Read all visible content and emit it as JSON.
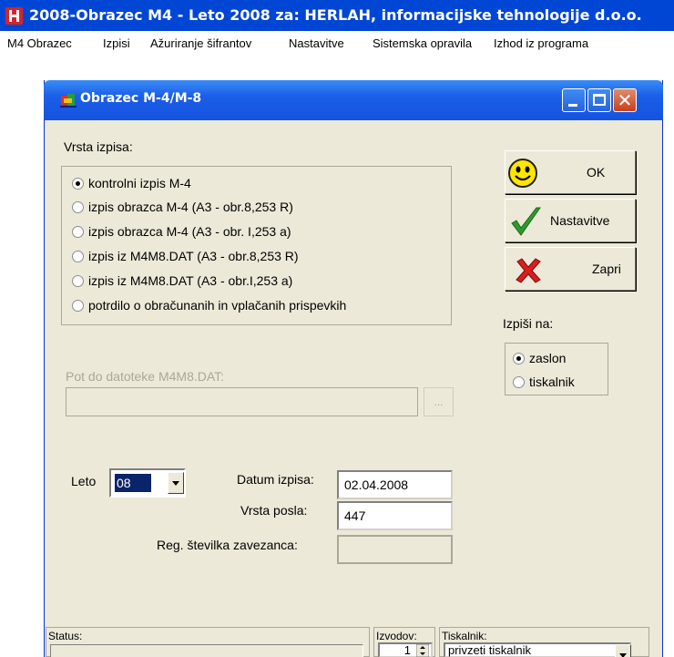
{
  "app": {
    "title": "2008-Obrazec M4 - Leto 2008 za: HERLAH, informacijske tehnologije d.o.o.",
    "icon": "app-logo-icon",
    "menu": [
      "M4 Obrazec",
      "Izpisi",
      "Ažuriranje šifrantov",
      "Nastavitve",
      "Sistemska opravila",
      "Izhod iz programa"
    ]
  },
  "dialog": {
    "title": "Obrazec M-4/M-8",
    "report_type_label": "Vrsta izpisa:",
    "report_options": [
      {
        "label": "kontrolni izpis M-4",
        "checked": true
      },
      {
        "label": "izpis obrazca M-4 (A3 - obr.8,253 R)",
        "checked": false
      },
      {
        "label": "izpis obrazca M-4 (A3 - obr. I,253 a)",
        "checked": false
      },
      {
        "label": "izpis iz M4M8.DAT (A3 - obr.8,253 R)",
        "checked": false
      },
      {
        "label": "izpis iz M4M8.DAT (A3 - obr.I,253 a)",
        "checked": false
      },
      {
        "label": "potrdilo o obračunanih in vplačanih prispevkih",
        "checked": false
      }
    ],
    "buttons": {
      "ok": "OK",
      "settings": "Nastavitve",
      "close": "Zapri"
    },
    "output_label": "Izpiši na:",
    "output_options": [
      {
        "label": "zaslon",
        "checked": true
      },
      {
        "label": "tiskalnik",
        "checked": false
      }
    ],
    "path_label": "Pot do datoteke M4M8.DAT:",
    "path_value": "",
    "browse_label": "...",
    "year_label": "Leto",
    "year_value": "08",
    "date_label": "Datum izpisa:",
    "date_value": "02.04.2008",
    "job_type_label": "Vrsta posla:",
    "job_type_value": "447",
    "reg_label": "Reg. številka zavezanca:",
    "reg_value": ""
  },
  "statusbar": {
    "status_label": "Status:",
    "status_value": "",
    "copies_label": "Izvodov:",
    "copies_value": "1",
    "printer_label": "Tiskalnik:",
    "printer_value": "privzeti tiskalnik"
  },
  "colors": {
    "titlebar": "#0046d5",
    "dialog_bg": "#ece9d8",
    "selection": "#0a246a"
  }
}
